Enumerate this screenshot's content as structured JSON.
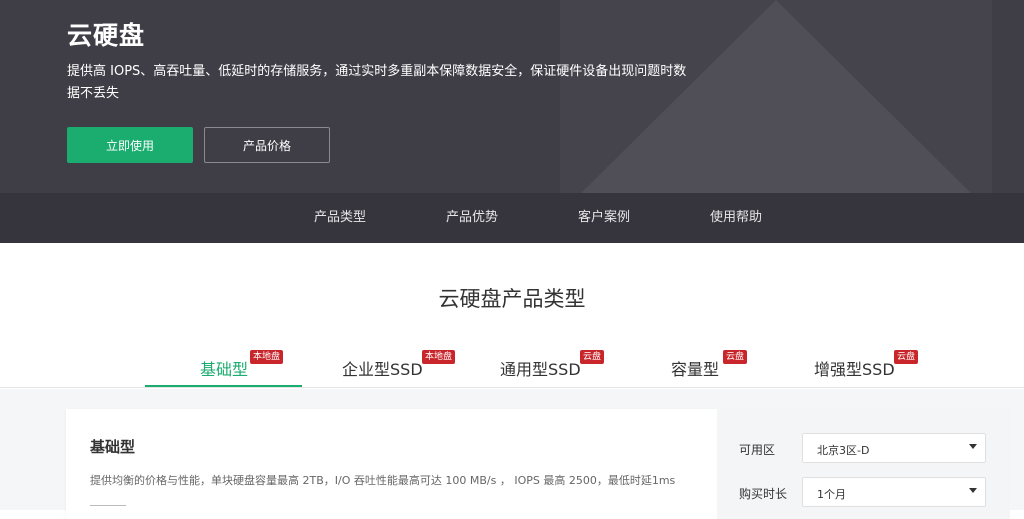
{
  "hero": {
    "title": "云硬盘",
    "description": "提供高 IOPS、高吞吐量、低延时的存储服务，通过实时多重副本保障数据安全，保证硬件设备出现问题时数据不丢失",
    "primary_button": "立即使用",
    "secondary_button": "产品价格"
  },
  "subnav": [
    "产品类型",
    "产品优势",
    "客户案例",
    "使用帮助"
  ],
  "section": {
    "title": "云硬盘产品类型"
  },
  "tabs": [
    {
      "label": "基础型",
      "badge": "本地盘",
      "active": true
    },
    {
      "label": "企业型SSD",
      "badge": "本地盘",
      "active": false
    },
    {
      "label": "通用型SSD",
      "badge": "云盘",
      "active": false
    },
    {
      "label": "容量型",
      "badge": "云盘",
      "active": false
    },
    {
      "label": "增强型SSD",
      "badge": "云盘",
      "active": false
    }
  ],
  "card": {
    "title": "基础型",
    "description": "提供均衡的价格与性能，单块硬盘容量最高 2TB，I/O 吞吐性能最高可达 100 MB/s ， IOPS 最高 2500，最低时延1ms"
  },
  "form": {
    "zone_label": "可用区",
    "zone_value": "北京3区-D",
    "duration_label": "购买时长",
    "duration_value": "1个月"
  },
  "colors": {
    "hero_bg": "#3f3e47",
    "accent": "#1aad6f",
    "badge": "#c8262b"
  }
}
